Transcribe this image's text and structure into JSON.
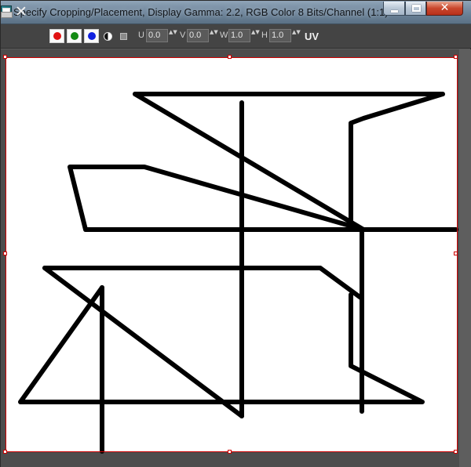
{
  "window": {
    "title": "Specify Cropping/Placement, Display Gamma: 2.2, RGB Color 8 Bits/Channel (1:1)",
    "close_glyph": "✕"
  },
  "toolbar": {
    "clear_glyph": "✕",
    "channels": [
      {
        "name": "red-channel",
        "color": "#e01010"
      },
      {
        "name": "green-channel",
        "color": "#138a13"
      },
      {
        "name": "blue-channel",
        "color": "#1020e0"
      }
    ],
    "u_label": "U",
    "u_value": "0.0",
    "v_label": "V",
    "v_value": "0.0",
    "w_label": "W",
    "w_value": "1.0",
    "h_label": "H",
    "h_value": "1.0",
    "uv_label": "UV",
    "spinner_glyph": "▲▼"
  }
}
